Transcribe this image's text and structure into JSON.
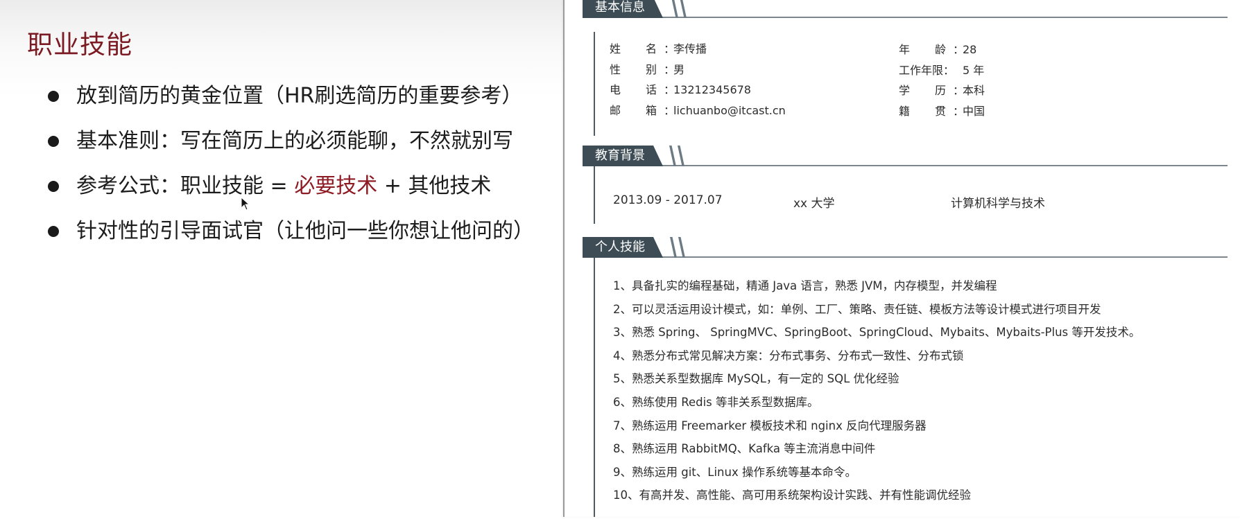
{
  "slide": {
    "title": "职业技能",
    "bullets": [
      "放到简历的黄金位置（HR刷选简历的重要参考）",
      "基本准则：写在简历上的必须能聊，不然就别写",
      "针对性的引导面试官（让他问一些你想让他问的）"
    ],
    "formula": {
      "prefix": "参考公式：职业技能 = ",
      "highlight": "必要技术",
      "suffix": " + 其他技术"
    },
    "accent_color": "#8e1b24"
  },
  "resume": {
    "sections": {
      "basic": "基本信息",
      "education": "教育背景",
      "skills": "个人技能"
    },
    "basic_left": [
      {
        "label": "姓　名：",
        "value": "李传播"
      },
      {
        "label": "性　别：",
        "value": "男"
      },
      {
        "label": "电　话：",
        "value": "13212345678"
      },
      {
        "label": "邮　箱：",
        "value": "lichuanbo@itcast.cn"
      }
    ],
    "basic_right": [
      {
        "label": "年　龄：",
        "value": "28"
      },
      {
        "label": "工作年限：",
        "value": "5 年"
      },
      {
        "label": "学　历：",
        "value": "本科"
      },
      {
        "label": "籍　贯：",
        "value": "中国"
      }
    ],
    "education": {
      "period": "2013.09 - 2017.07",
      "school": "xx 大学",
      "major": "计算机科学与技术"
    },
    "skills": [
      "1、具备扎实的编程基础，精通 Java 语言，熟悉 JVM，内存模型，并发编程",
      "2、可以灵活运用设计模式，如：单例、工厂、策略、责任链、模板方法等设计模式进行项目开发",
      "3、熟悉 Spring、 SpringMVC、SpringBoot、SpringCloud、Mybaits、Mybaits-Plus 等开发技术。",
      "4、熟悉分布式常见解决方案：分布式事务、分布式一致性、分布式锁",
      "5、熟悉关系型数据库 MySQL，有一定的 SQL 优化经验",
      "6、熟练使用 Redis 等非关系型数据库。",
      "7、熟练运用 Freemarker 模板技术和 nginx 反向代理服务器",
      "8、熟练运用 RabbitMQ、Kafka 等主流消息中间件",
      "9、熟练运用 git、Linux 操作系统等基本命令。",
      "10、有高并发、高性能、高可用系统架构设计实践、并有性能调优经验"
    ],
    "header_color": "#3e4c56"
  }
}
